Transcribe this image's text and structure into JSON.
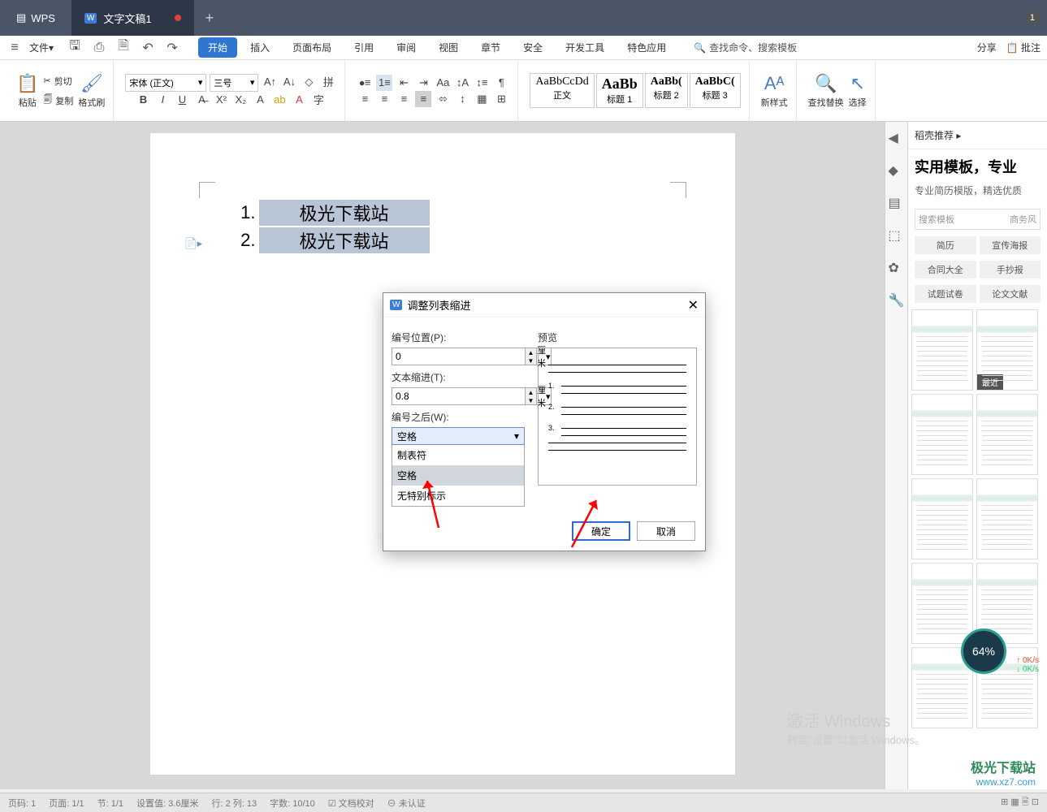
{
  "titlebar": {
    "app": "WPS",
    "doc": "文字文稿1",
    "badge": "1"
  },
  "menu": {
    "file": "文件",
    "tabs": [
      "开始",
      "插入",
      "页面布局",
      "引用",
      "审阅",
      "视图",
      "章节",
      "安全",
      "开发工具",
      "特色应用"
    ],
    "search": "查找命令、搜索模板",
    "right": [
      "分享",
      "批注"
    ]
  },
  "ribbon": {
    "paste": "粘贴",
    "cut": "剪切",
    "copy": "复制",
    "format_painter": "格式刷",
    "font_name": "宋体 (正文)",
    "font_size": "三号",
    "styles": [
      {
        "sample": "AaBbCcDd",
        "name": "正文"
      },
      {
        "sample": "AaBb",
        "name": "标题 1"
      },
      {
        "sample": "AaBb(",
        "name": "标题 2"
      },
      {
        "sample": "AaBbC(",
        "name": "标题 3"
      }
    ],
    "new_style": "新样式",
    "find_replace": "查找替换",
    "select": "选择"
  },
  "doc": {
    "items": [
      "1.",
      "2."
    ],
    "text": "极光下载站"
  },
  "dialog": {
    "title": "调整列表缩进",
    "num_pos_label": "编号位置(P):",
    "num_pos_val": "0",
    "text_indent_label": "文本缩进(T):",
    "text_indent_val": "0.8",
    "unit": "厘米",
    "after_num_label": "编号之后(W):",
    "after_num_val": "空格",
    "options": [
      "制表符",
      "空格",
      "无特别标示"
    ],
    "preview": "预览",
    "ok": "确定",
    "cancel": "取消"
  },
  "panel": {
    "title": "稻壳推荐",
    "big": "实用模板，专业",
    "sub": "专业简历模版，精选优质",
    "search": "搜索模板",
    "search_tab": "商务风",
    "tags": [
      [
        "简历",
        "宣传海报"
      ],
      [
        "合同大全",
        "手抄报"
      ],
      [
        "试题试卷",
        "论文文献"
      ]
    ],
    "recent": "最近"
  },
  "status": {
    "page_no": "页码: 1",
    "page": "页面: 1/1",
    "section": "节: 1/1",
    "set_val": "设置值: 3.6厘米",
    "row_col": "行: 2 列: 13",
    "word_count": "字数: 10/10",
    "spellcheck": "文档校对",
    "unauth": "未认证"
  },
  "watermark": {
    "l1": "激活 Windows",
    "l2": "转到\"设置\"以激活 Windows。"
  },
  "site": "极光下载站",
  "site_url": "www.xz7.com",
  "meter": "64%",
  "speed": "0K/s"
}
